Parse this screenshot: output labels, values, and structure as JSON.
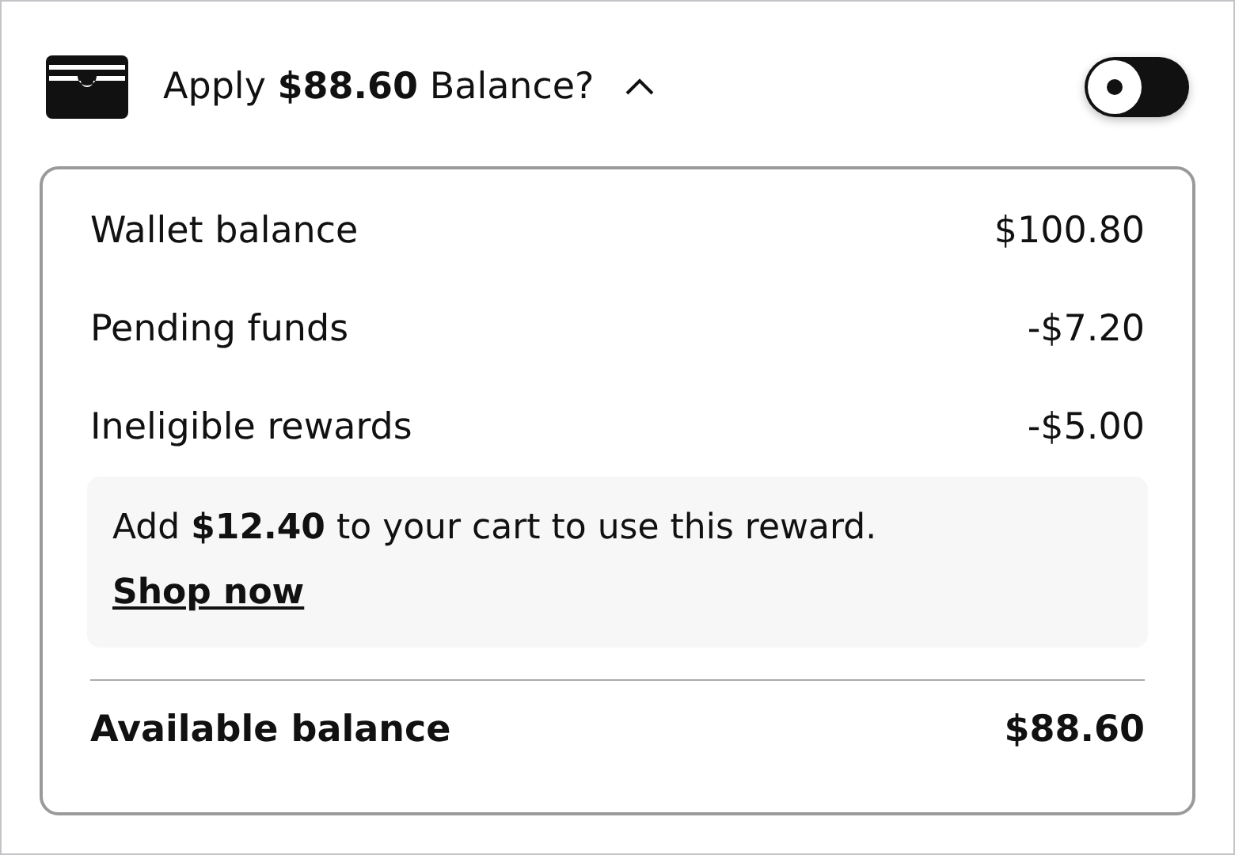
{
  "header": {
    "title": "Apply **$88.60** Balance?",
    "expanded": true,
    "toggle": {
      "on": false
    }
  },
  "rows": [
    {
      "label": "Wallet balance",
      "value": "$100.80"
    },
    {
      "label": "Pending funds",
      "value": "-$7.20"
    },
    {
      "label": "Ineligible rewards",
      "value": "-$5.00"
    }
  ],
  "notice": {
    "text": "Add **$12.40** to your cart to use this reward.",
    "link": "Shop now"
  },
  "total": {
    "label": "Available balance",
    "value": "$88.60"
  }
}
